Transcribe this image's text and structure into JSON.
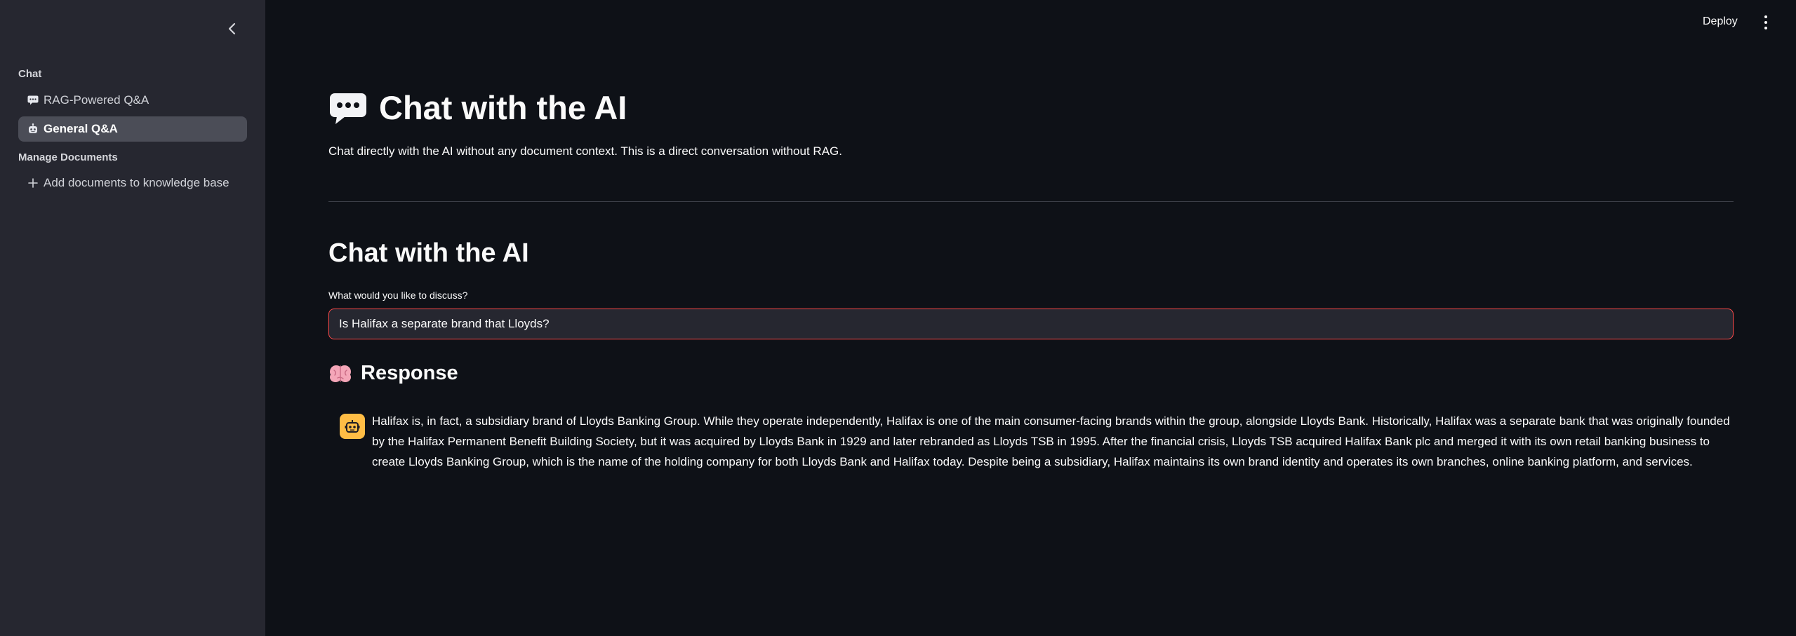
{
  "sidebar": {
    "sections": [
      {
        "label": "Chat",
        "items": [
          {
            "label": "RAG-Powered Q&A",
            "icon": "speech-balloon-icon",
            "active": false
          },
          {
            "label": "General Q&A",
            "icon": "robot-icon",
            "active": true
          }
        ]
      },
      {
        "label": "Manage Documents",
        "items": [
          {
            "label": "Add documents to knowledge base",
            "icon": "plus-icon",
            "active": false
          }
        ]
      }
    ]
  },
  "topbar": {
    "deploy_label": "Deploy",
    "menu_icon": "kebab-menu-icon"
  },
  "main": {
    "title": "Chat with the AI",
    "title_icon": "speech-balloon-icon",
    "subtitle": "Chat directly with the AI without any document context. This is a direct conversation without RAG.",
    "section_title": "Chat with the AI",
    "input_label": "What would you like to discuss?",
    "input_value": "Is Halifax a separate brand that Lloyds?",
    "response_header": "Response",
    "response_icon": "brain-icon",
    "message": {
      "avatar_icon": "bot-icon",
      "text": "Halifax is, in fact, a subsidiary brand of Lloyds Banking Group. While they operate independently, Halifax is one of the main consumer-facing brands within the group, alongside Lloyds Bank. Historically, Halifax was a separate bank that was originally founded by the Halifax Permanent Benefit Building Society, but it was acquired by Lloyds Bank in 1929 and later rebranded as Lloyds TSB in 1995. After the financial crisis, Lloyds TSB acquired Halifax Bank plc and merged it with its own retail banking business to create Lloyds Banking Group, which is the name of the holding company for both Lloyds Bank and Halifax today. Despite being a subsidiary, Halifax maintains its own brand identity and operates its own branches, online banking platform, and services."
    }
  },
  "colors": {
    "background": "#0e1117",
    "sidebar": "#262730",
    "active_nav": "#4b4d57",
    "input_border": "#ff4b4b",
    "avatar": "#ffbd45"
  }
}
